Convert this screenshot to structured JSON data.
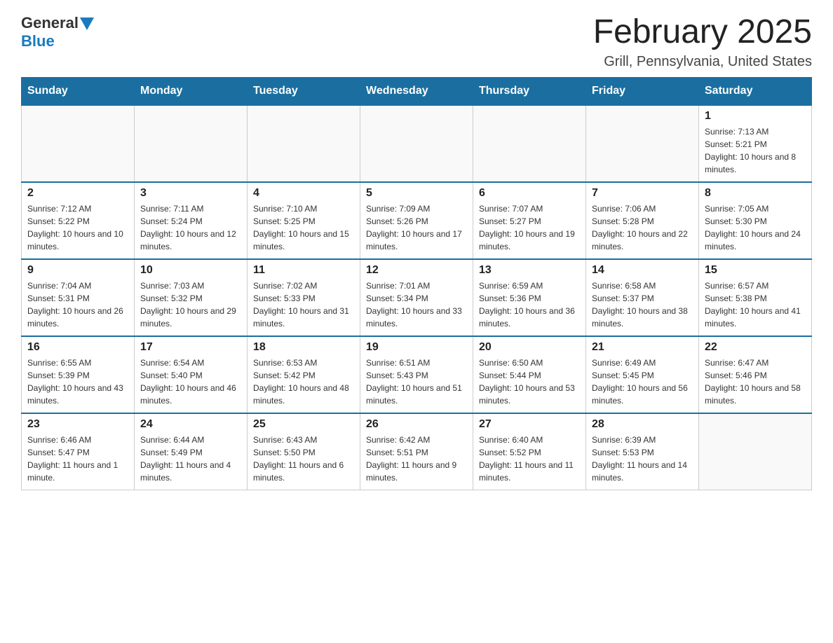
{
  "logo": {
    "general": "General",
    "blue": "Blue"
  },
  "title": "February 2025",
  "location": "Grill, Pennsylvania, United States",
  "days_of_week": [
    "Sunday",
    "Monday",
    "Tuesday",
    "Wednesday",
    "Thursday",
    "Friday",
    "Saturday"
  ],
  "weeks": [
    [
      {
        "day": "",
        "info": ""
      },
      {
        "day": "",
        "info": ""
      },
      {
        "day": "",
        "info": ""
      },
      {
        "day": "",
        "info": ""
      },
      {
        "day": "",
        "info": ""
      },
      {
        "day": "",
        "info": ""
      },
      {
        "day": "1",
        "info": "Sunrise: 7:13 AM\nSunset: 5:21 PM\nDaylight: 10 hours and 8 minutes."
      }
    ],
    [
      {
        "day": "2",
        "info": "Sunrise: 7:12 AM\nSunset: 5:22 PM\nDaylight: 10 hours and 10 minutes."
      },
      {
        "day": "3",
        "info": "Sunrise: 7:11 AM\nSunset: 5:24 PM\nDaylight: 10 hours and 12 minutes."
      },
      {
        "day": "4",
        "info": "Sunrise: 7:10 AM\nSunset: 5:25 PM\nDaylight: 10 hours and 15 minutes."
      },
      {
        "day": "5",
        "info": "Sunrise: 7:09 AM\nSunset: 5:26 PM\nDaylight: 10 hours and 17 minutes."
      },
      {
        "day": "6",
        "info": "Sunrise: 7:07 AM\nSunset: 5:27 PM\nDaylight: 10 hours and 19 minutes."
      },
      {
        "day": "7",
        "info": "Sunrise: 7:06 AM\nSunset: 5:28 PM\nDaylight: 10 hours and 22 minutes."
      },
      {
        "day": "8",
        "info": "Sunrise: 7:05 AM\nSunset: 5:30 PM\nDaylight: 10 hours and 24 minutes."
      }
    ],
    [
      {
        "day": "9",
        "info": "Sunrise: 7:04 AM\nSunset: 5:31 PM\nDaylight: 10 hours and 26 minutes."
      },
      {
        "day": "10",
        "info": "Sunrise: 7:03 AM\nSunset: 5:32 PM\nDaylight: 10 hours and 29 minutes."
      },
      {
        "day": "11",
        "info": "Sunrise: 7:02 AM\nSunset: 5:33 PM\nDaylight: 10 hours and 31 minutes."
      },
      {
        "day": "12",
        "info": "Sunrise: 7:01 AM\nSunset: 5:34 PM\nDaylight: 10 hours and 33 minutes."
      },
      {
        "day": "13",
        "info": "Sunrise: 6:59 AM\nSunset: 5:36 PM\nDaylight: 10 hours and 36 minutes."
      },
      {
        "day": "14",
        "info": "Sunrise: 6:58 AM\nSunset: 5:37 PM\nDaylight: 10 hours and 38 minutes."
      },
      {
        "day": "15",
        "info": "Sunrise: 6:57 AM\nSunset: 5:38 PM\nDaylight: 10 hours and 41 minutes."
      }
    ],
    [
      {
        "day": "16",
        "info": "Sunrise: 6:55 AM\nSunset: 5:39 PM\nDaylight: 10 hours and 43 minutes."
      },
      {
        "day": "17",
        "info": "Sunrise: 6:54 AM\nSunset: 5:40 PM\nDaylight: 10 hours and 46 minutes."
      },
      {
        "day": "18",
        "info": "Sunrise: 6:53 AM\nSunset: 5:42 PM\nDaylight: 10 hours and 48 minutes."
      },
      {
        "day": "19",
        "info": "Sunrise: 6:51 AM\nSunset: 5:43 PM\nDaylight: 10 hours and 51 minutes."
      },
      {
        "day": "20",
        "info": "Sunrise: 6:50 AM\nSunset: 5:44 PM\nDaylight: 10 hours and 53 minutes."
      },
      {
        "day": "21",
        "info": "Sunrise: 6:49 AM\nSunset: 5:45 PM\nDaylight: 10 hours and 56 minutes."
      },
      {
        "day": "22",
        "info": "Sunrise: 6:47 AM\nSunset: 5:46 PM\nDaylight: 10 hours and 58 minutes."
      }
    ],
    [
      {
        "day": "23",
        "info": "Sunrise: 6:46 AM\nSunset: 5:47 PM\nDaylight: 11 hours and 1 minute."
      },
      {
        "day": "24",
        "info": "Sunrise: 6:44 AM\nSunset: 5:49 PM\nDaylight: 11 hours and 4 minutes."
      },
      {
        "day": "25",
        "info": "Sunrise: 6:43 AM\nSunset: 5:50 PM\nDaylight: 11 hours and 6 minutes."
      },
      {
        "day": "26",
        "info": "Sunrise: 6:42 AM\nSunset: 5:51 PM\nDaylight: 11 hours and 9 minutes."
      },
      {
        "day": "27",
        "info": "Sunrise: 6:40 AM\nSunset: 5:52 PM\nDaylight: 11 hours and 11 minutes."
      },
      {
        "day": "28",
        "info": "Sunrise: 6:39 AM\nSunset: 5:53 PM\nDaylight: 11 hours and 14 minutes."
      },
      {
        "day": "",
        "info": ""
      }
    ]
  ]
}
